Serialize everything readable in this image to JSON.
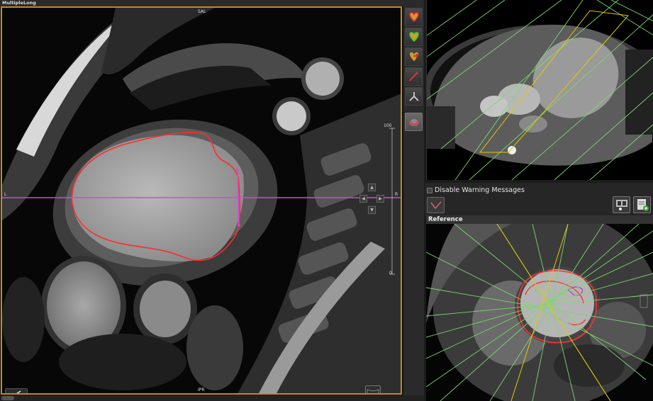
{
  "main_view": {
    "title": "MultipleLong",
    "orient_top": "SAL",
    "orient_bottom": "IPR",
    "orient_left": "L",
    "orient_right": "R",
    "scale_max": "100",
    "scale_min": "0"
  },
  "toolbar": {
    "tools": [
      "contour-tool-1-icon",
      "contour-tool-2-icon",
      "contour-tool-3-icon",
      "spline-tool-icon",
      "measure-tool-icon",
      "3d-view-icon"
    ]
  },
  "controls": {
    "disable_warning_label": "Disable Warning Messages"
  },
  "reference": {
    "header": "Reference"
  },
  "colors": {
    "frame_border": "#c08a2c",
    "contour": "#ff2b2b",
    "line": "#e040e0",
    "green_lines": "#7bd86f",
    "yellow_lines": "#e6c800"
  }
}
